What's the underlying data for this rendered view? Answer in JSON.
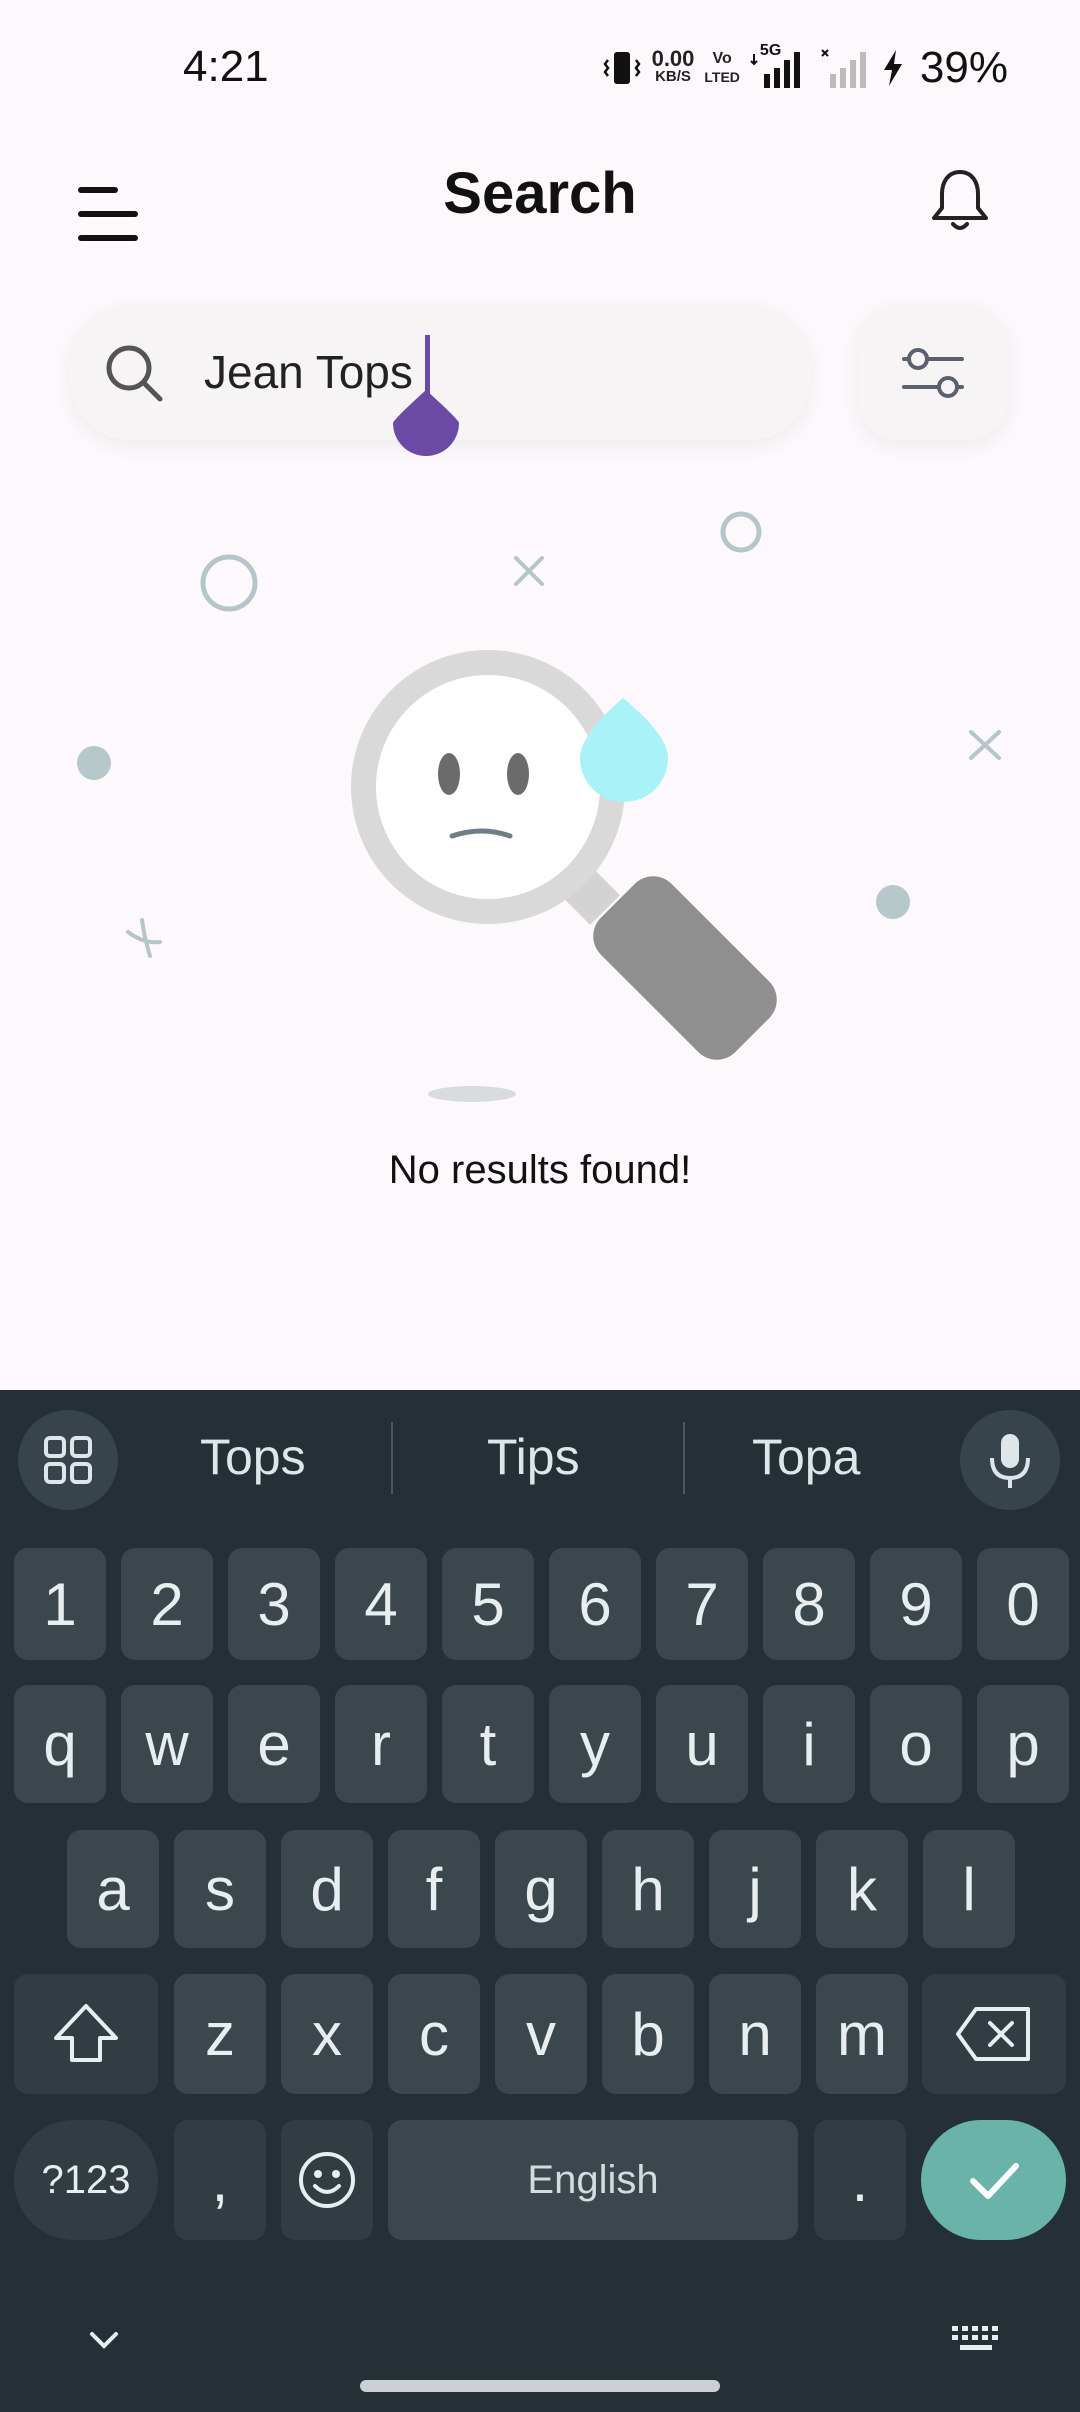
{
  "status_bar": {
    "time": "4:21",
    "net_speed_value": "0.00",
    "net_speed_unit": "KB/S",
    "volte_top": "Vo",
    "volte_bottom": "LTED",
    "network": "5G",
    "battery": "39%"
  },
  "header": {
    "title": "Search",
    "menu_icon": "hamburger-menu-icon",
    "bell_icon": "bell-icon"
  },
  "search": {
    "value": "Jean Tops",
    "icon": "search-icon",
    "filter_icon": "filter-sliders-icon"
  },
  "empty_state": {
    "message": "No results found!"
  },
  "keyboard": {
    "suggestions": [
      "Tops",
      "Tips",
      "Topa"
    ],
    "row_numbers": [
      "1",
      "2",
      "3",
      "4",
      "5",
      "6",
      "7",
      "8",
      "9",
      "0"
    ],
    "row_q": [
      "q",
      "w",
      "e",
      "r",
      "t",
      "y",
      "u",
      "i",
      "o",
      "p"
    ],
    "row_a": [
      "a",
      "s",
      "d",
      "f",
      "g",
      "h",
      "j",
      "k",
      "l"
    ],
    "row_z": [
      "z",
      "x",
      "c",
      "v",
      "b",
      "n",
      "m"
    ],
    "symbols_label": "?123",
    "comma": ",",
    "space_label": "English",
    "period": ".",
    "colors": {
      "background": "#253036",
      "key": "#3c474d",
      "enter": "#6ab3a8"
    }
  },
  "colors": {
    "accent": "#6a4aa5",
    "background": "#fdf8fb"
  }
}
